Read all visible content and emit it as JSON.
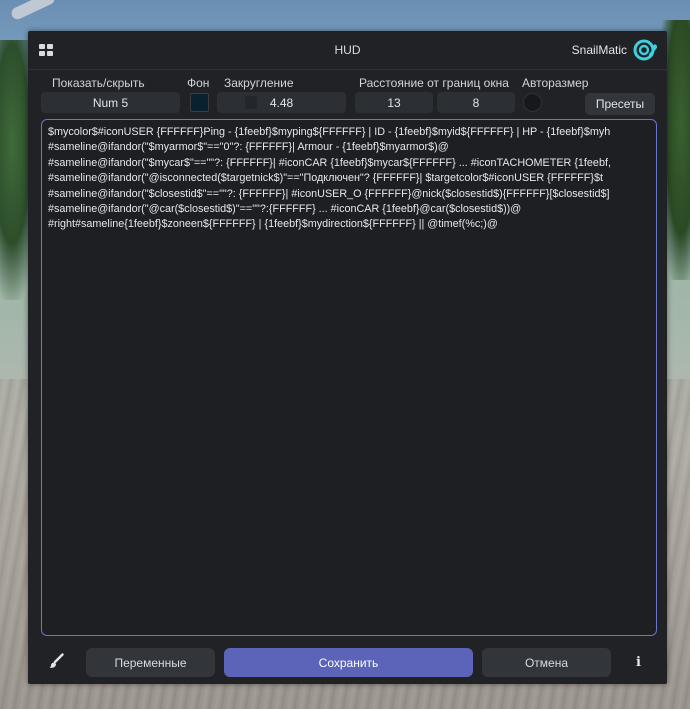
{
  "window": {
    "title": "HUD",
    "brand": "SnailMatic",
    "menu_icon": "grid-icon",
    "logo_icon": "snail-logo-icon"
  },
  "settings": {
    "toggle_label": "Показать/скрыть",
    "toggle_key": "Num 5",
    "background_label": "Фон",
    "background_color": "#0a2230",
    "rounding_label": "Закругление",
    "rounding_value": "4.48",
    "margins_label": "Расстояние от границ окна",
    "margin_x": "13",
    "margin_y": "8",
    "autosize_label": "Авторазмер",
    "autosize_on": false,
    "presets_label": "Пресеты"
  },
  "editor": {
    "lines": [
      "$mycolor$#iconUSER {FFFFFF}Ping - {1feebf}$myping${FFFFFF} | ID - {1feebf}$myid${FFFFFF} | HP - {1feebf}$myh",
      "#sameline@ifandor(\"$myarmor$\"==\"0\"?: {FFFFFF}| Armour - {1feebf}$myarmor$)@",
      "#sameline@ifandor(\"$mycar$\"==\"\"?: {FFFFFF}| #iconCAR {1feebf}$mycar${FFFFFF} ... #iconTACHOMETER {1feebf,",
      "#sameline@ifandor(\"@isconnected($targetnick$)\"==\"Подключен\"? {FFFFFF}| $targetcolor$#iconUSER {FFFFFF}$t",
      "#sameline@ifandor(\"$closestid$\"==\"\"?: {FFFFFF}| #iconUSER_O {FFFFFF}@nick($closestid$){FFFFFF}[$closestid$]",
      "#sameline@ifandor(\"@car($closestid$)\"==\"\"?:{FFFFFF} ... #iconCAR {1feebf}@car($closestid$))@",
      "#right#sameline{1feebf}$zoneen${FFFFFF} | {1feebf}$mydirection${FFFFFF} || @timef(%c;)@"
    ],
    "accent_border": "#6a76c9"
  },
  "footer": {
    "brush_icon": "brush-icon",
    "variables_label": "Переменные",
    "save_label": "Сохранить",
    "cancel_label": "Отмена",
    "info_icon": "info-icon",
    "info_glyph": "i",
    "save_color": "#5b64b8"
  }
}
